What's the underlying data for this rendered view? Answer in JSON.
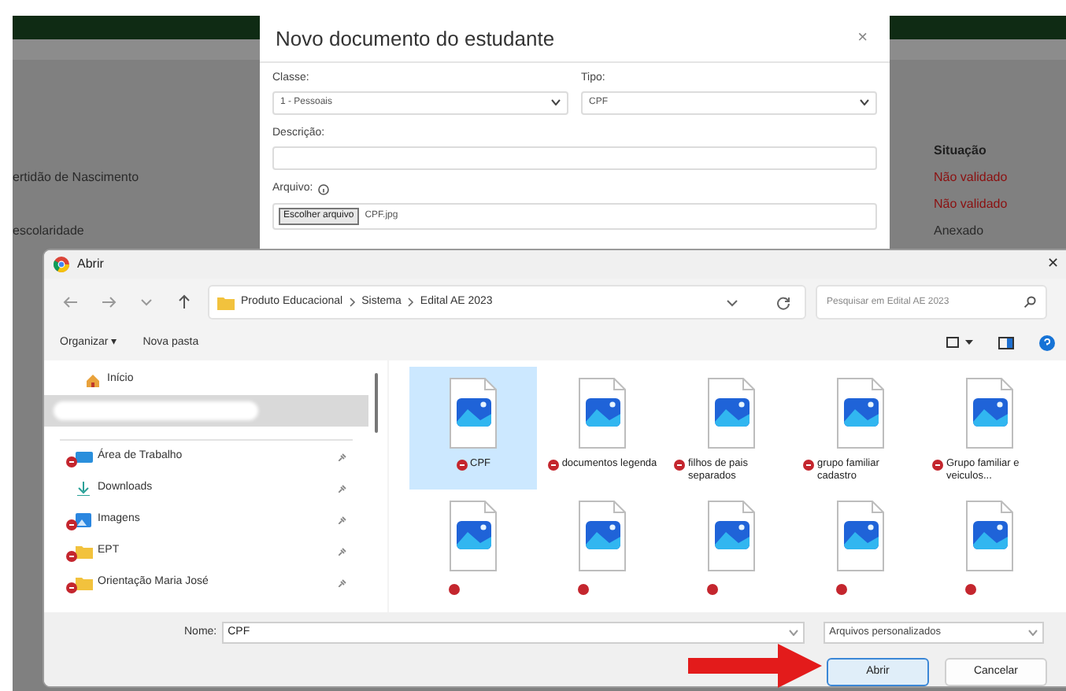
{
  "background_page": {
    "status_heading": "Situação",
    "rows": [
      {
        "document": "ertidão de Nascimento",
        "status": "Não validado",
        "color": "#8b0f0f"
      },
      {
        "status": "Não validado",
        "color": "#8b0f0f"
      },
      {
        "document": "escolaridade",
        "status": "Anexado",
        "color": "#2a2a2a"
      }
    ]
  },
  "modal": {
    "title": "Novo documento do estudante",
    "close": "×",
    "class_label": "Classe:",
    "class_value": "1 - Pessoais",
    "type_label": "Tipo:",
    "type_value": "CPF",
    "description_label": "Descrição:",
    "file_label": "Arquivo:",
    "file_button": "Escolher arquivo",
    "file_name": "CPF.jpg"
  },
  "file_dialog": {
    "title": "Abrir",
    "close": "✕",
    "path": [
      "Produto Educacional",
      "Sistema",
      "Edital AE 2023"
    ],
    "search_placeholder": "Pesquisar em Edital AE 2023",
    "toolbar": [
      "Organizar ▾",
      "Nova pasta"
    ],
    "nav_items": [
      {
        "kind": "home",
        "label": "Início",
        "selected": false,
        "sync_error": false,
        "pinned": false
      },
      {
        "kind": "redacted",
        "selected": true,
        "sync_error": false,
        "pinned": false
      },
      {
        "kind": "desktop",
        "label": "Área de Trabalho",
        "selected": false,
        "sync_error": true,
        "pinned": true
      },
      {
        "kind": "download",
        "label": "Downloads",
        "selected": false,
        "sync_error": false,
        "pinned": true
      },
      {
        "kind": "pictures",
        "label": "Imagens",
        "selected": false,
        "sync_error": true,
        "pinned": true
      },
      {
        "kind": "folder",
        "label": "EPT",
        "selected": false,
        "sync_error": true,
        "pinned": true
      },
      {
        "kind": "folder",
        "label": "Orientação Maria José",
        "selected": false,
        "sync_error": true,
        "pinned": true
      }
    ],
    "files": [
      {
        "name": "CPF",
        "selected": true,
        "sync_error": true
      },
      {
        "name": "documentos legenda",
        "selected": false,
        "sync_error": true
      },
      {
        "name": "filhos de pais separados",
        "selected": false,
        "sync_error": true
      },
      {
        "name": "grupo familiar cadastro",
        "selected": false,
        "sync_error": true
      },
      {
        "name": "Grupo familiar e veiculos...",
        "selected": false,
        "sync_error": true
      },
      {
        "selected": false,
        "sync_error": true
      },
      {
        "selected": false,
        "sync_error": true
      },
      {
        "selected": false,
        "sync_error": true
      },
      {
        "selected": false,
        "sync_error": true
      },
      {
        "selected": false,
        "sync_error": true
      }
    ],
    "name_label": "Nome:",
    "name_value": "CPF",
    "file_type": "Arquivos personalizados",
    "buttons": [
      {
        "label": "Abrir",
        "selected": true
      },
      {
        "label": "Cancelar",
        "selected": false
      }
    ]
  }
}
